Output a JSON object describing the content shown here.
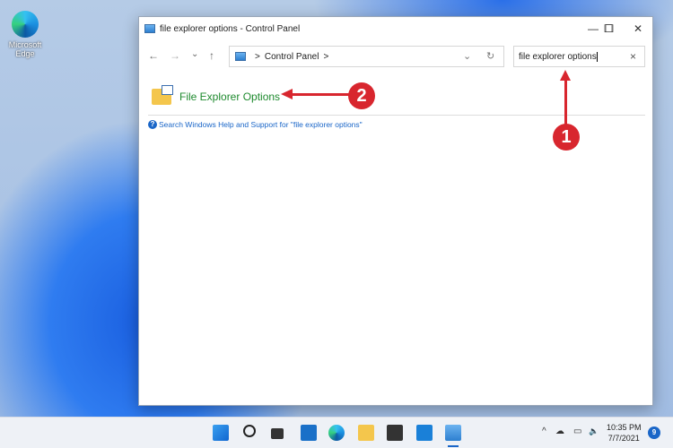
{
  "desktop": {
    "icons": [
      {
        "label": "Microsoft Edge"
      }
    ]
  },
  "window": {
    "title": "file explorer options - Control Panel",
    "controls": {
      "minimize": "—",
      "maximize": "☐",
      "close": "✕"
    },
    "nav": {
      "back": "←",
      "forward": "→",
      "recent": "⌄",
      "up": "↑"
    },
    "address": {
      "sep1": ">",
      "location": "Control Panel",
      "sep2": ">",
      "dropdown": "⌄",
      "refresh": "↻"
    },
    "search": {
      "value": "file explorer options",
      "clear": "×"
    },
    "results": [
      {
        "label": "File Explorer Options"
      }
    ],
    "help_link": "Search Windows Help and Support for \"file explorer options\""
  },
  "annotations": [
    {
      "number": "1",
      "color": "#d8262e"
    },
    {
      "number": "2",
      "color": "#d8262e"
    }
  ],
  "taskbar": {
    "apps": [
      "start-icon",
      "search-icon",
      "task-view-icon",
      "widgets-icon",
      "edge-icon",
      "file-explorer-icon",
      "store-icon",
      "mail-icon",
      "control-panel-icon"
    ],
    "tray": {
      "chevron": "^",
      "cloud": "☁",
      "network": "▭",
      "volume": "🔈"
    },
    "time": "10:35 PM",
    "date": "7/7/2021",
    "notification_count": "9"
  }
}
